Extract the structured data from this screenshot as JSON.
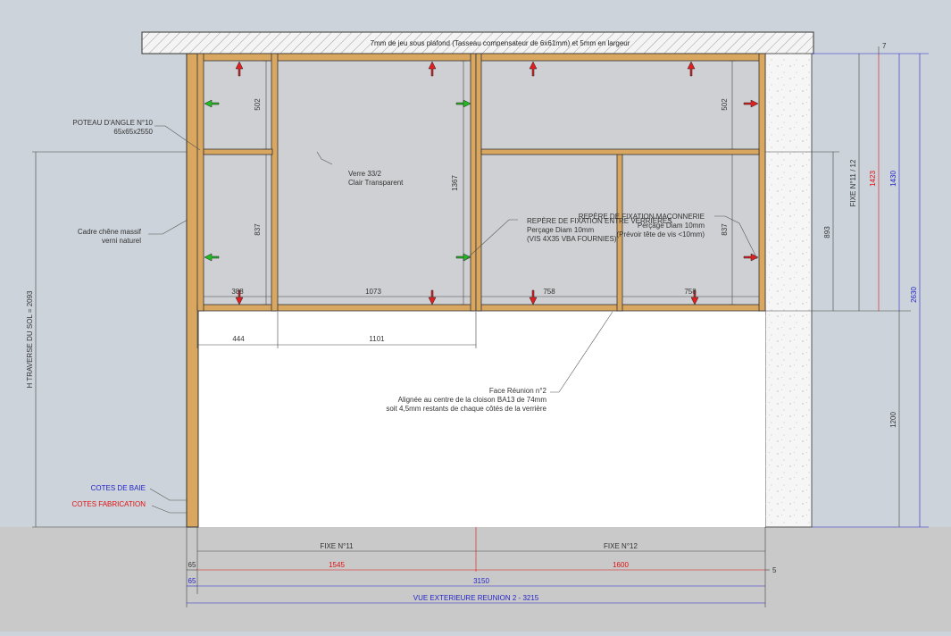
{
  "ceiling_note": "7mm de jeu sous plafond (Tasseau compensateur de 6x61mm) et 5mm en largeur",
  "corner_post": {
    "title": "POTEAU D'ANGLE N°10",
    "size": "65x65x2550"
  },
  "frame_note": {
    "line1": "Cadre chêne massif",
    "line2": "verni naturel"
  },
  "glass_note": {
    "line1": "Verre 33/2",
    "line2": "Clair Transparent"
  },
  "fixing_between": {
    "line1": "REPÈRE DE FIXATION ENTRE VERRIÈRES",
    "line2": "Perçage Diam 10mm",
    "line3": "(VIS 4X35 VBA FOURNIES)"
  },
  "fixing_masonry": {
    "line1": "REPÈRE DE FIXATION MAÇONNERIE",
    "line2": "Perçage Diam 10mm",
    "line3": "(Prévoir tête de vis <10mm)"
  },
  "reunion_face": {
    "line1": "Face Réunion n°2",
    "line2": "Alignée au centre de la cloison BA13 de 74mm",
    "line3": "soit 4,5mm restants de chaque côtés de la verrière"
  },
  "legend": {
    "bay": "COTES DE BAIE",
    "fabrication": "COTES FABRICATION"
  },
  "labels": {
    "height_floor": "H TRAVERSE DU SOL = 2093",
    "fixe_side": "FIXE N°11 / 12",
    "fixe11": "FIXE N°11",
    "fixe12": "FIXE N°12",
    "total_view": "VUE EXTERIEURE REUNION 2 - 3215"
  },
  "dims": {
    "d502a": "502",
    "d837a": "837",
    "d1367": "1367",
    "d502b": "502",
    "d837b": "837",
    "d388": "388",
    "d1073": "1073",
    "d758a": "758",
    "d758b": "758",
    "d444": "444",
    "d1101": "1101",
    "d893": "893",
    "d1423": "1423",
    "d1430": "1430",
    "d2630": "2630",
    "d1200": "1200",
    "d7": "7",
    "d65a": "65",
    "d1545": "1545",
    "d1600": "1600",
    "d5": "5",
    "d65b": "65",
    "d3150": "3150"
  },
  "colors": {
    "background": "#ccd3da",
    "glass": "#cfd0d3",
    "oak": "#d9a760",
    "dimension_blue": "#2424c8",
    "dimension_red": "#e01010",
    "arrow_red": "#e02020",
    "arrow_green": "#22bb22"
  }
}
